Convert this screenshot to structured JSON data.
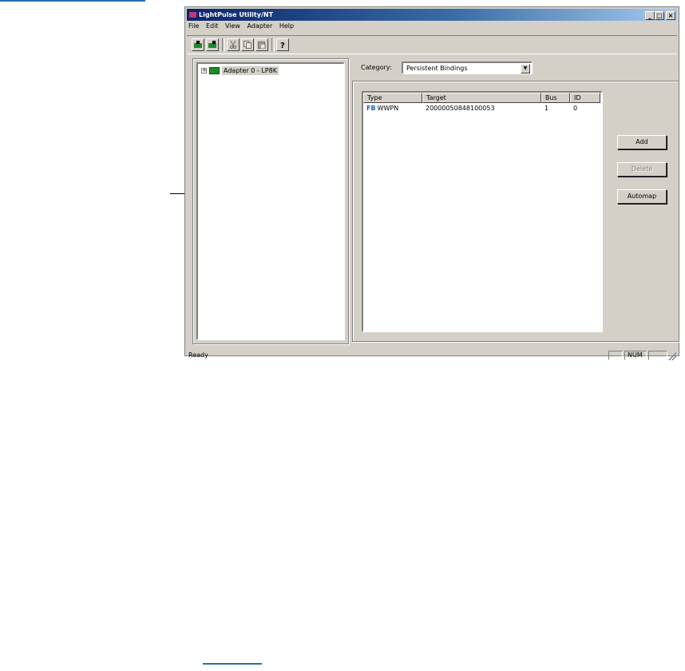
{
  "window": {
    "title": "LightPulse Utility/NT"
  },
  "menu": [
    "File",
    "Edit",
    "View",
    "Adapter",
    "Help"
  ],
  "toolbar": {
    "icons": [
      "adapter-reset-icon",
      "adapter-refresh-icon",
      "cut-icon",
      "copy-icon",
      "paste-icon",
      "help-icon"
    ]
  },
  "tree": {
    "root_label": "Adapter 0 - LP8K",
    "expander": "+"
  },
  "category": {
    "label": "Category:",
    "value": "Persistent Bindings"
  },
  "bindings": {
    "columns": [
      "Type",
      "Target",
      "Bus",
      "ID"
    ],
    "rows": [
      {
        "icon": "FB",
        "type": "WWPN",
        "target": "20000050848100053",
        "bus": "1",
        "id": "0"
      }
    ]
  },
  "buttons": {
    "add": "Add",
    "delete": "Delete",
    "automap": "Automap"
  },
  "status": {
    "text": "Ready",
    "num": "NUM"
  },
  "colors": {
    "titlebar_start": "#0a246a",
    "face": "#d4d0c8",
    "accent_rule": "#2b6cb0"
  }
}
